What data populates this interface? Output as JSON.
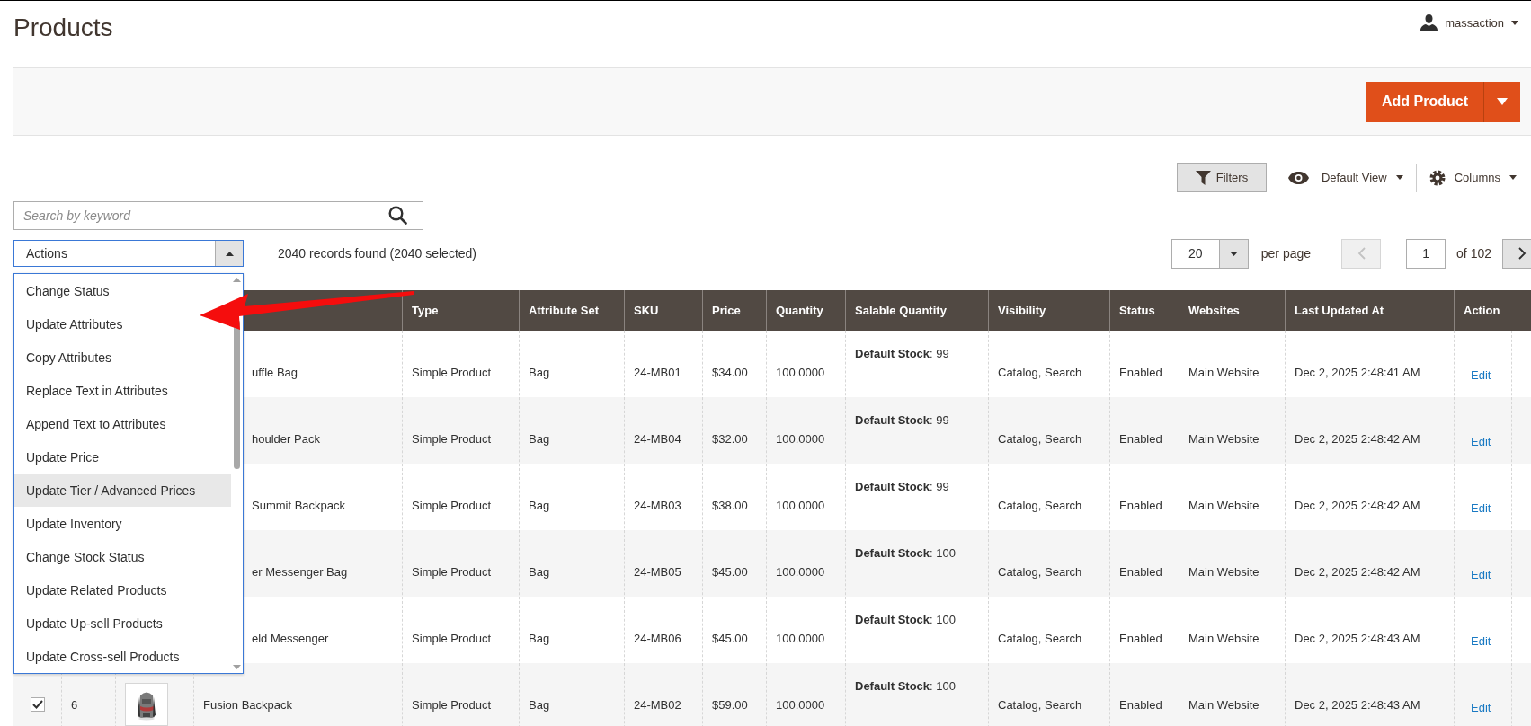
{
  "page_title": "Products",
  "user": {
    "name": "massaction"
  },
  "add_button": {
    "label": "Add Product"
  },
  "toolbar": {
    "filters": "Filters",
    "view": "Default View",
    "columns": "Columns"
  },
  "search": {
    "placeholder": "Search by keyword"
  },
  "actions": {
    "label": "Actions",
    "expanded": true,
    "options": [
      {
        "label": "Change Status",
        "selected": false
      },
      {
        "label": "Update Attributes",
        "selected": false
      },
      {
        "label": "Copy Attributes",
        "selected": false
      },
      {
        "label": "Replace Text in Attributes",
        "selected": false
      },
      {
        "label": "Append Text to Attributes",
        "selected": false
      },
      {
        "label": "Update Price",
        "selected": false
      },
      {
        "label": "Update Tier / Advanced Prices",
        "selected": true
      },
      {
        "label": "Update Inventory",
        "selected": false
      },
      {
        "label": "Change Stock Status",
        "selected": false
      },
      {
        "label": "Update Related Products",
        "selected": false
      },
      {
        "label": "Update Up-sell Products",
        "selected": false
      },
      {
        "label": "Update Cross-sell Products",
        "selected": false
      }
    ]
  },
  "records": "2040 records found (2040 selected)",
  "pagination": {
    "per_page": "20",
    "per_page_label": "per page",
    "prev": {
      "disabled": true
    },
    "page": "1",
    "of": "of 102",
    "next": {
      "disabled": false
    }
  },
  "table": {
    "columns": [
      "Type",
      "Attribute Set",
      "SKU",
      "Price",
      "Quantity",
      "Salable Quantity",
      "Visibility",
      "Status",
      "Websites",
      "Last Updated At",
      "Action"
    ],
    "rows": [
      {
        "name": "uffle Bag",
        "type": "Simple Product",
        "attribute_set": "Bag",
        "sku": "24-MB01",
        "price": "$34.00",
        "quantity": "100.0000",
        "salable": "**Default Stock**: 99",
        "visibility": "Catalog, Search",
        "status": "Enabled",
        "websites": "Main Website",
        "updated": "Dec 2, 2025 2:48:41 AM",
        "action": "Edit"
      },
      {
        "name": "houlder Pack",
        "type": "Simple Product",
        "attribute_set": "Bag",
        "sku": "24-MB04",
        "price": "$32.00",
        "quantity": "100.0000",
        "salable": "**Default Stock**: 99",
        "visibility": "Catalog, Search",
        "status": "Enabled",
        "websites": "Main Website",
        "updated": "Dec 2, 2025 2:48:42 AM",
        "action": "Edit"
      },
      {
        "name": "Summit Backpack",
        "type": "Simple Product",
        "attribute_set": "Bag",
        "sku": "24-MB03",
        "price": "$38.00",
        "quantity": "100.0000",
        "salable": "**Default Stock**: 99",
        "visibility": "Catalog, Search",
        "status": "Enabled",
        "websites": "Main Website",
        "updated": "Dec 2, 2025 2:48:42 AM",
        "action": "Edit"
      },
      {
        "name": "er Messenger Bag",
        "type": "Simple Product",
        "attribute_set": "Bag",
        "sku": "24-MB05",
        "price": "$45.00",
        "quantity": "100.0000",
        "salable": "**Default Stock**: 100",
        "visibility": "Catalog, Search",
        "status": "Enabled",
        "websites": "Main Website",
        "updated": "Dec 2, 2025 2:48:42 AM",
        "action": "Edit"
      },
      {
        "name": "eld Messenger",
        "type": "Simple Product",
        "attribute_set": "Bag",
        "sku": "24-MB06",
        "price": "$45.00",
        "quantity": "100.0000",
        "salable": "**Default Stock**: 100",
        "visibility": "Catalog, Search",
        "status": "Enabled",
        "websites": "Main Website",
        "updated": "Dec 2, 2025 2:48:43 AM",
        "action": "Edit"
      },
      {
        "checked": true,
        "id": "6",
        "name": "Fusion Backpack",
        "type": "Simple Product",
        "attribute_set": "Bag",
        "sku": "24-MB02",
        "price": "$59.00",
        "quantity": "100.0000",
        "salable": "**Default Stock**: 100",
        "visibility": "Catalog, Search",
        "status": "Enabled",
        "websites": "Main Website",
        "updated": "Dec 2, 2025 2:48:43 AM",
        "action": "Edit"
      }
    ]
  }
}
